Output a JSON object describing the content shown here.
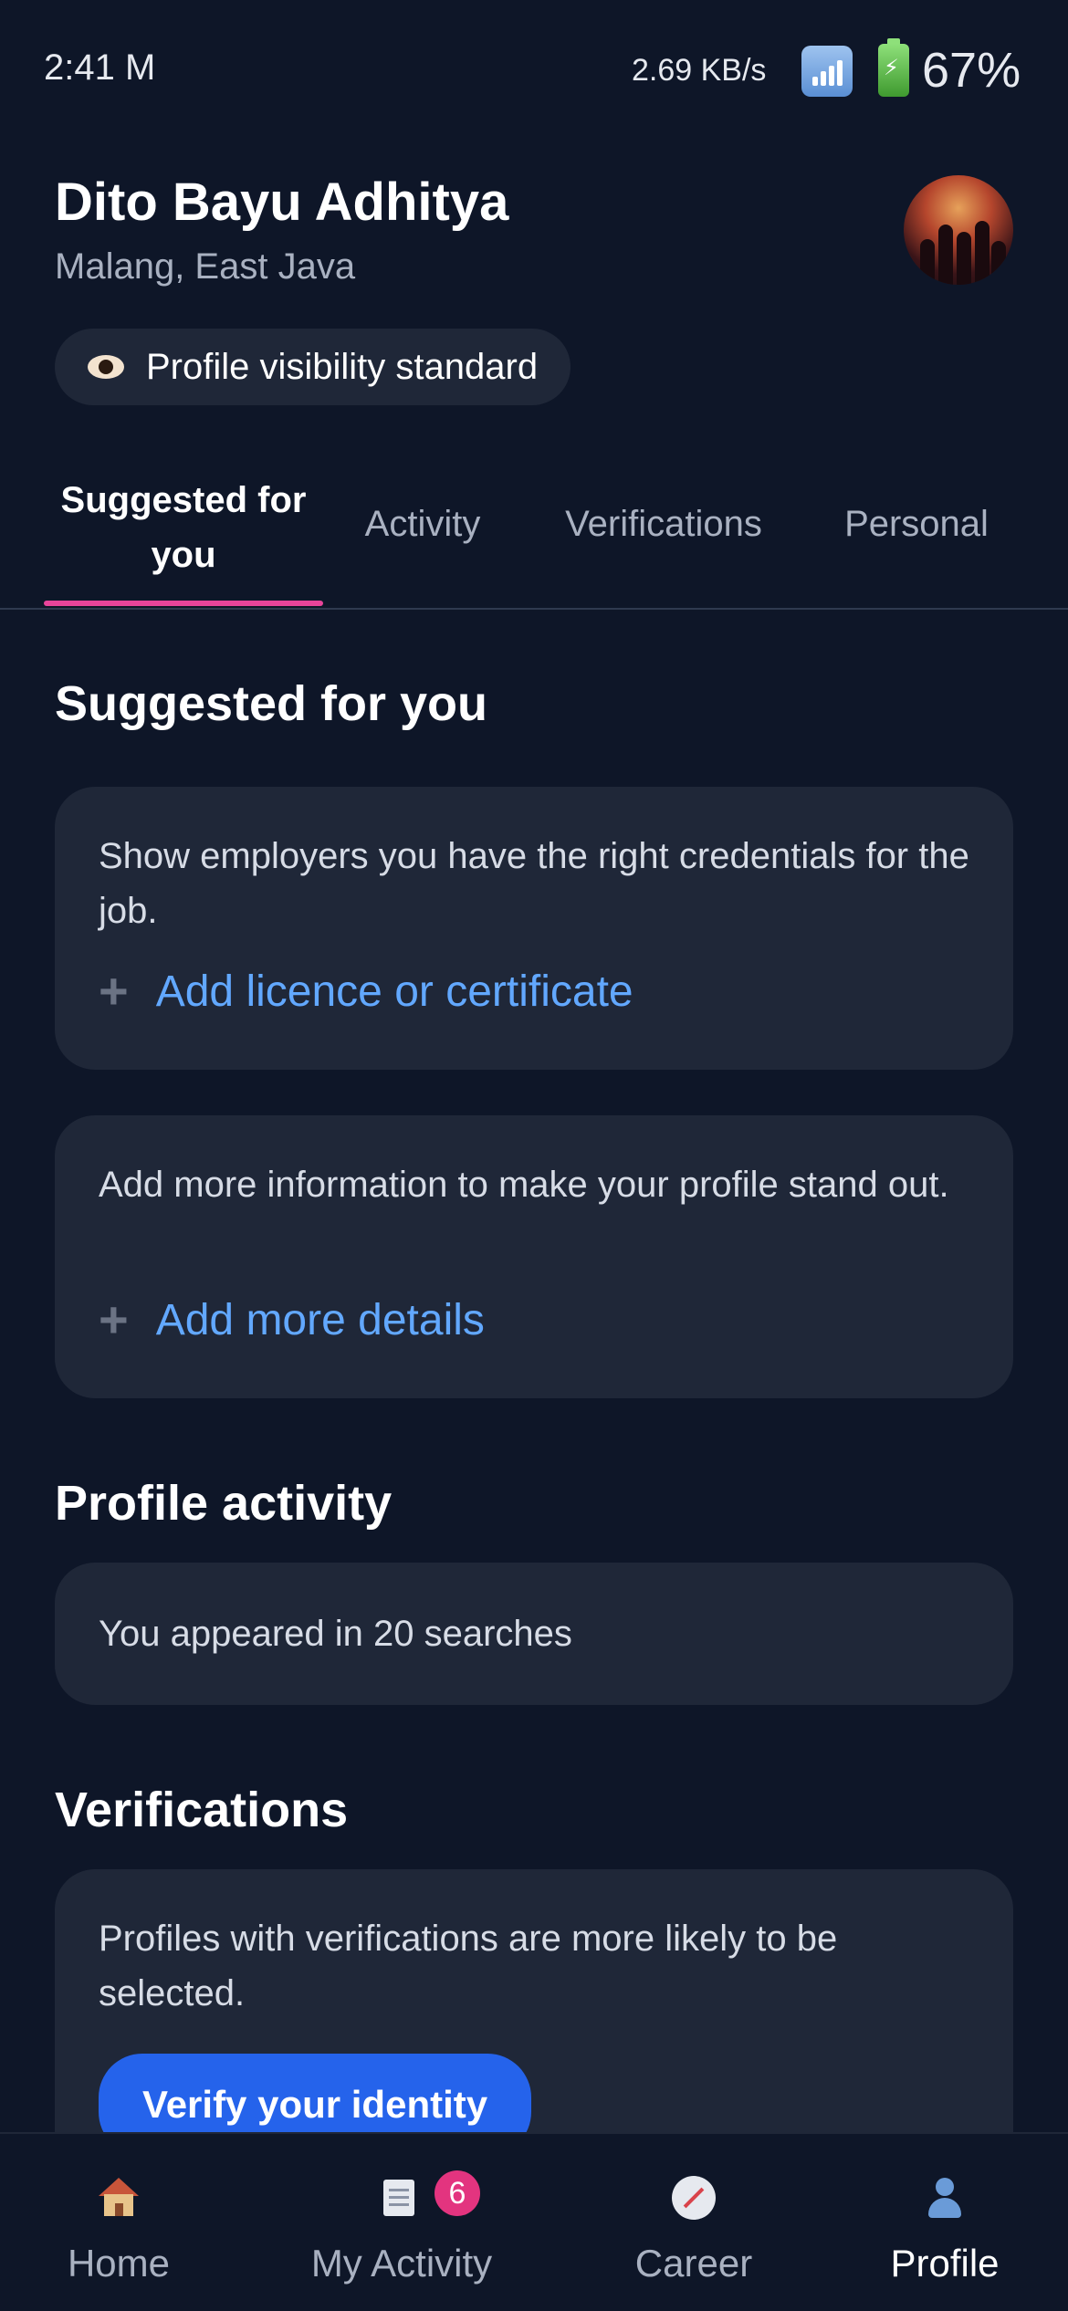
{
  "status_bar": {
    "time": "2:41 M",
    "network_speed": "2.69 KB/s",
    "battery": "67%"
  },
  "profile": {
    "name": "Dito Bayu Adhitya",
    "location": "Malang, East Java",
    "visibility": "Profile visibility standard"
  },
  "tabs": [
    {
      "label": "Suggested for you",
      "active": true
    },
    {
      "label": "Activity",
      "active": false
    },
    {
      "label": "Verifications",
      "active": false
    },
    {
      "label": "Personal",
      "active": false
    }
  ],
  "suggested": {
    "title": "Suggested for you",
    "cards": [
      {
        "text": "Show employers you have the right credentials for the job.",
        "link": "Add licence or certificate"
      },
      {
        "text": "Add more information to make your profile stand out.",
        "link": "Add more details"
      }
    ]
  },
  "activity": {
    "title": "Profile activity",
    "text": "You appeared in 20 searches"
  },
  "verifications": {
    "title": "Verifications",
    "text": "Profiles with verifications are more likely to be selected.",
    "button": "Verify your identity"
  },
  "bottom_nav": [
    {
      "label": "Home",
      "icon": "home-icon",
      "active": false
    },
    {
      "label": "My Activity",
      "icon": "document-icon",
      "badge": "6",
      "active": false
    },
    {
      "label": "Career",
      "icon": "compass-icon",
      "active": false
    },
    {
      "label": "Profile",
      "icon": "person-icon",
      "active": true
    }
  ],
  "colors": {
    "background": "#0e1628",
    "card": "#1f2738",
    "accent_link": "#62a8ff",
    "tab_indicator": "#e8449a",
    "primary_button": "#2563eb",
    "badge": "#e3347f"
  }
}
